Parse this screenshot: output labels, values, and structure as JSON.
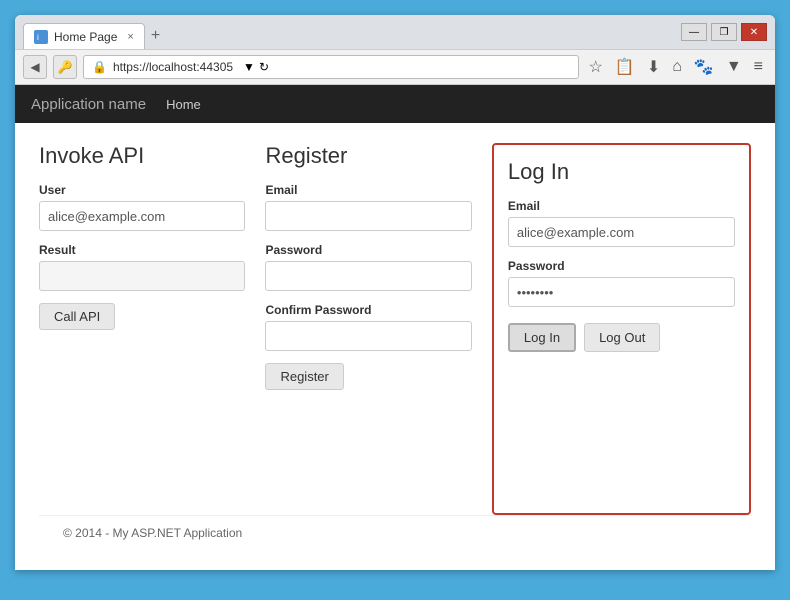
{
  "browser": {
    "tab_title": "Home Page",
    "tab_close": "×",
    "tab_new": "+",
    "url": "https://localhost:44305",
    "win_minimize": "—",
    "win_restore": "❐",
    "win_close": "✕"
  },
  "navbar": {
    "app_name": "Application name",
    "nav_home": "Home"
  },
  "invoke_api": {
    "title": "Invoke API",
    "user_label": "User",
    "user_value": "alice@example.com",
    "result_label": "Result",
    "result_value": "",
    "call_api_btn": "Call API"
  },
  "register": {
    "title": "Register",
    "email_label": "Email",
    "password_label": "Password",
    "confirm_label": "Confirm Password",
    "register_btn": "Register"
  },
  "login": {
    "title": "Log In",
    "email_label": "Email",
    "email_value": "alice@example.com",
    "password_label": "Password",
    "password_value": "••••••••",
    "login_btn": "Log In",
    "logout_btn": "Log Out"
  },
  "footer": {
    "text": "© 2014 - My ASP.NET Application"
  },
  "icons": {
    "back": "◀",
    "key": "🔑",
    "lock": "🔒",
    "refresh": "↻",
    "star": "☆",
    "clipboard": "📋",
    "download": "⬇",
    "home": "⌂",
    "settings": "⚙",
    "dropdown": "▼",
    "menu": "≡"
  }
}
